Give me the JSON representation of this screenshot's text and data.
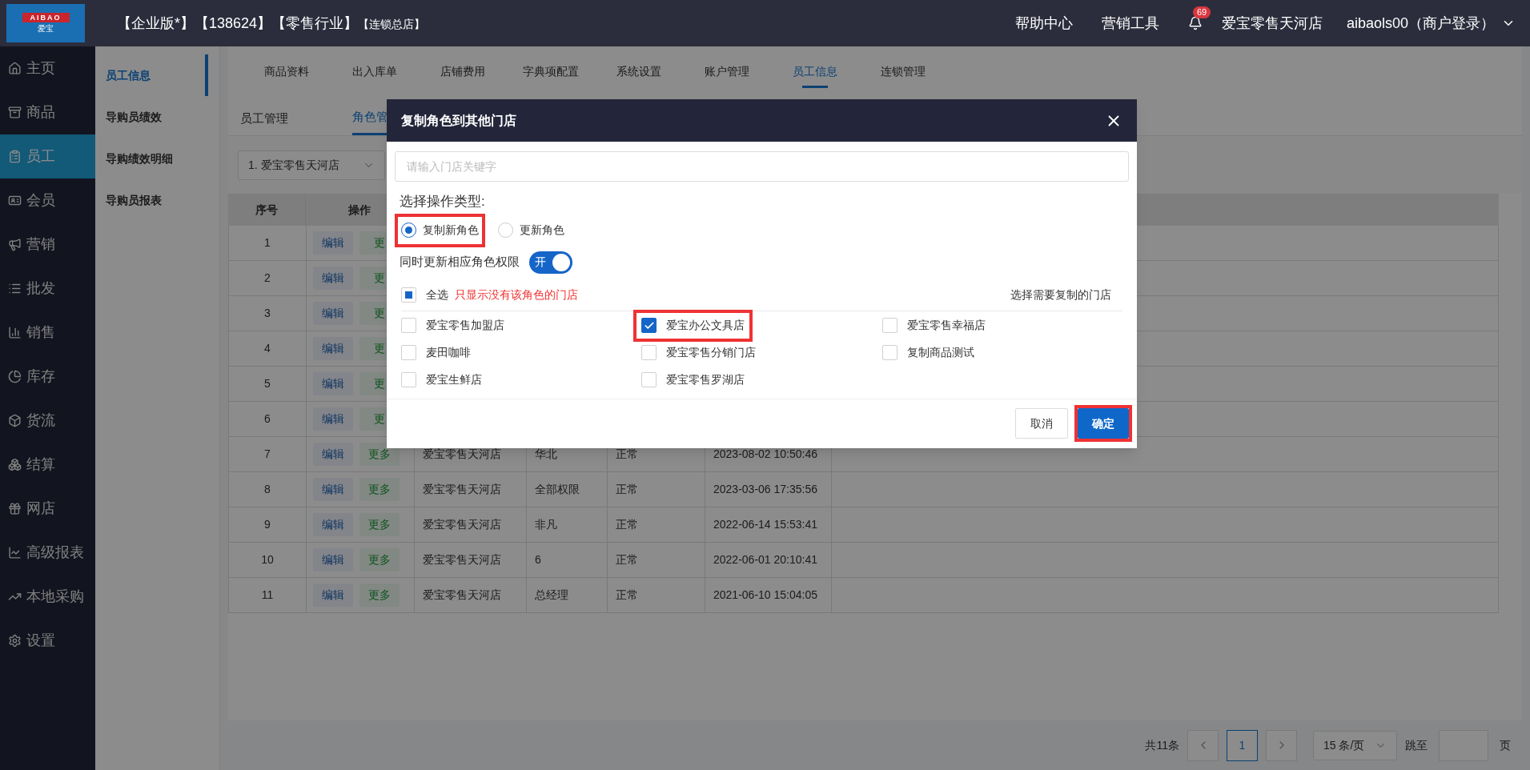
{
  "header": {
    "logo": {
      "latin": "AIBAO",
      "chinese": "爱宝"
    },
    "edition": "【企业版*】【138624】【零售行业】",
    "store_type": "【连锁总店】",
    "links": [
      "帮助中心",
      "营销工具"
    ],
    "notifications": "69",
    "store": "爱宝零售天河店",
    "account": "aibaols00（商户登录）"
  },
  "sidebar": {
    "items": [
      {
        "label": "主页",
        "selected": false
      },
      {
        "label": "商品",
        "selected": false
      },
      {
        "label": "员工",
        "selected": true
      },
      {
        "label": "会员",
        "selected": false
      },
      {
        "label": "营销",
        "selected": false
      },
      {
        "label": "批发",
        "selected": false
      },
      {
        "label": "销售",
        "selected": false
      },
      {
        "label": "库存",
        "selected": false
      },
      {
        "label": "货流",
        "selected": false
      },
      {
        "label": "结算",
        "selected": false
      },
      {
        "label": "网店",
        "selected": false
      },
      {
        "label": "高级报表",
        "selected": false
      },
      {
        "label": "本地采购",
        "selected": false
      },
      {
        "label": "设置",
        "selected": false
      }
    ]
  },
  "subnav": {
    "items": [
      {
        "label": "员工信息",
        "selected": true
      },
      {
        "label": "导购员绩效",
        "selected": false
      },
      {
        "label": "导购绩效明细",
        "selected": false
      },
      {
        "label": "导购员报表",
        "selected": false
      }
    ]
  },
  "tabs": [
    {
      "label": "商品资料",
      "selected": false
    },
    {
      "label": "出入库单",
      "selected": false
    },
    {
      "label": "店铺费用",
      "selected": false
    },
    {
      "label": "字典项配置",
      "selected": false
    },
    {
      "label": "系统设置",
      "selected": false
    },
    {
      "label": "账户管理",
      "selected": false
    },
    {
      "label": "员工信息",
      "selected": true
    },
    {
      "label": "连锁管理",
      "selected": false
    }
  ],
  "subtabs": [
    {
      "label": "员工管理",
      "selected": false
    },
    {
      "label": "角色管",
      "selected": true
    }
  ],
  "store_select": {
    "value": "1. 爱宝零售天河店"
  },
  "table": {
    "columns": [
      "序号",
      "操作"
    ],
    "rows": [
      {
        "no": "1",
        "actions": [
          "编辑",
          "更"
        ],
        "cells": []
      },
      {
        "no": "2",
        "actions": [
          "编辑",
          "更"
        ],
        "cells": []
      },
      {
        "no": "3",
        "actions": [
          "编辑",
          "更"
        ],
        "cells": []
      },
      {
        "no": "4",
        "actions": [
          "编辑",
          "更"
        ],
        "cells": []
      },
      {
        "no": "5",
        "actions": [
          "编辑",
          "更"
        ],
        "cells": []
      },
      {
        "no": "6",
        "actions": [
          "编辑",
          "更"
        ],
        "cells": []
      },
      {
        "no": "7",
        "actions": [
          "编辑",
          "更多"
        ],
        "cells": [
          "爱宝零售天河店",
          "华北",
          "正常",
          "2023-08-02 10:50:46"
        ]
      },
      {
        "no": "8",
        "actions": [
          "编辑",
          "更多"
        ],
        "cells": [
          "爱宝零售天河店",
          "全部权限",
          "正常",
          "2023-03-06 17:35:56"
        ]
      },
      {
        "no": "9",
        "actions": [
          "编辑",
          "更多"
        ],
        "cells": [
          "爱宝零售天河店",
          "非凡",
          "正常",
          "2022-06-14 15:53:41"
        ]
      },
      {
        "no": "10",
        "actions": [
          "编辑",
          "更多"
        ],
        "cells": [
          "爱宝零售天河店",
          "6",
          "正常",
          "2022-06-01 20:10:41"
        ]
      },
      {
        "no": "11",
        "actions": [
          "编辑",
          "更多"
        ],
        "cells": [
          "爱宝零售天河店",
          "总经理",
          "正常",
          "2021-06-10 15:04:05"
        ]
      }
    ]
  },
  "pagination": {
    "total": "共11条",
    "pages": [
      {
        "label": "1",
        "selected": true
      }
    ],
    "page_size": "15 条/页",
    "jump_label": "跳至",
    "page_unit": "页"
  },
  "dialog": {
    "title": "复制角色到其他门店",
    "search": {
      "placeholder": "请输入门店关键字"
    },
    "type_label": "选择操作类型:",
    "radios": [
      {
        "label": "复制新角色",
        "selected": true,
        "highlighted": true
      },
      {
        "label": "更新角色",
        "selected": false,
        "highlighted": false
      }
    ],
    "sync": {
      "label": "同时更新相应角色权限",
      "on": true,
      "text": "开"
    },
    "select_all": {
      "label": "全选",
      "indeterminate": true
    },
    "note": "只显示没有该角色的门店",
    "stores_label": "选择需要复制的门店",
    "stores": [
      {
        "label": "爱宝零售加盟店",
        "checked": false,
        "highlighted": false
      },
      {
        "label": "爱宝办公文具店",
        "checked": true,
        "highlighted": true
      },
      {
        "label": "爱宝零售幸福店",
        "checked": false,
        "highlighted": false
      },
      {
        "label": "麦田咖啡",
        "checked": false,
        "highlighted": false
      },
      {
        "label": "爱宝零售分销门店",
        "checked": false,
        "highlighted": false
      },
      {
        "label": "复制商品测试",
        "checked": false,
        "highlighted": false
      },
      {
        "label": "爱宝生鲜店",
        "checked": false,
        "highlighted": false
      },
      {
        "label": "爱宝零售罗湖店",
        "checked": false,
        "highlighted": false
      }
    ],
    "buttons": [
      {
        "label": "取消",
        "kind": "secondary",
        "highlighted": false
      },
      {
        "label": "确定",
        "kind": "primary",
        "highlighted": true
      }
    ]
  }
}
